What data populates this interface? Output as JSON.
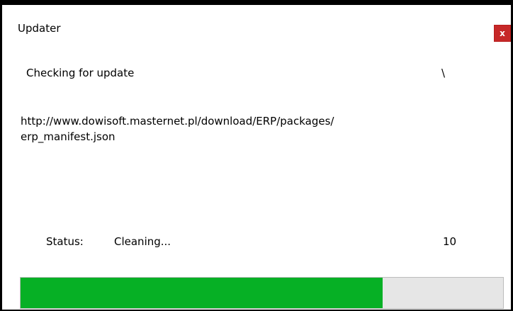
{
  "window": {
    "title": "Updater",
    "close_label": "x"
  },
  "main": {
    "message": "Checking for update",
    "spinner": "\\",
    "url_line1": "http://www.dowisoft.masternet.pl/download/ERP/packages/",
    "url_line2": "erp_manifest.json"
  },
  "status": {
    "label": "Status:",
    "value": "Cleaning...",
    "count": "10"
  },
  "progress": {
    "fraction": 0.75,
    "fill_color": "#06b025",
    "track_color": "#e6e6e6"
  }
}
